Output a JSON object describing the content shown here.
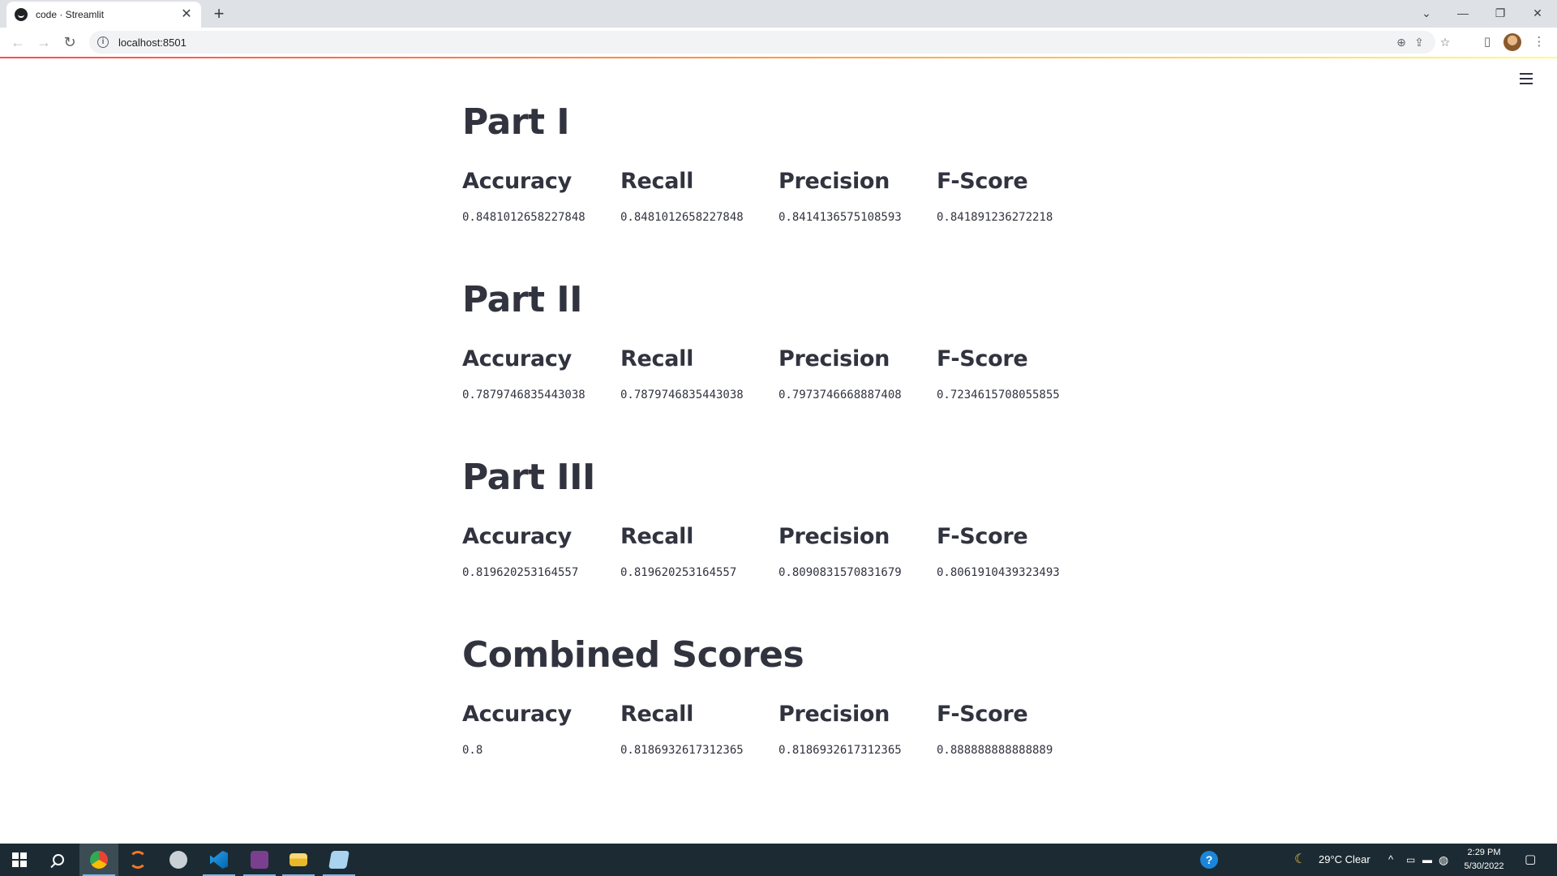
{
  "browser": {
    "tab_title": "code · Streamlit",
    "url": "localhost:8501",
    "close_glyph": "✕",
    "new_tab_glyph": "+",
    "window_controls": [
      "⌄",
      "—",
      "❐",
      "✕"
    ]
  },
  "streamlit": {
    "accent_colors": [
      "#ff4b4b",
      "#fffd80"
    ],
    "text_color": "#31333f"
  },
  "sections": [
    {
      "title": "Part I",
      "metrics": [
        {
          "label": "Accuracy",
          "value": "0.8481012658227848"
        },
        {
          "label": "Recall",
          "value": "0.8481012658227848"
        },
        {
          "label": "Precision",
          "value": "0.8414136575108593"
        },
        {
          "label": "F-Score",
          "value": "0.841891236272218"
        }
      ]
    },
    {
      "title": "Part II",
      "metrics": [
        {
          "label": "Accuracy",
          "value": "0.7879746835443038"
        },
        {
          "label": "Recall",
          "value": "0.7879746835443038"
        },
        {
          "label": "Precision",
          "value": "0.7973746668887408"
        },
        {
          "label": "F-Score",
          "value": "0.7234615708055855"
        }
      ]
    },
    {
      "title": "Part III",
      "metrics": [
        {
          "label": "Accuracy",
          "value": "0.819620253164557"
        },
        {
          "label": "Recall",
          "value": "0.819620253164557"
        },
        {
          "label": "Precision",
          "value": "0.8090831570831679"
        },
        {
          "label": "F-Score",
          "value": "0.8061910439323493"
        }
      ]
    },
    {
      "title": "Combined Scores",
      "metrics": [
        {
          "label": "Accuracy",
          "value": "0.8"
        },
        {
          "label": "Recall",
          "value": "0.8186932617312365"
        },
        {
          "label": "Precision",
          "value": "0.8186932617312365"
        },
        {
          "label": "F-Score",
          "value": "0.888888888888889"
        }
      ]
    }
  ],
  "taskbar": {
    "weather": "29°C  Clear",
    "time": "2:29 PM",
    "date": "5/30/2022",
    "help_glyph": "?",
    "chevron_glyph": "^"
  }
}
